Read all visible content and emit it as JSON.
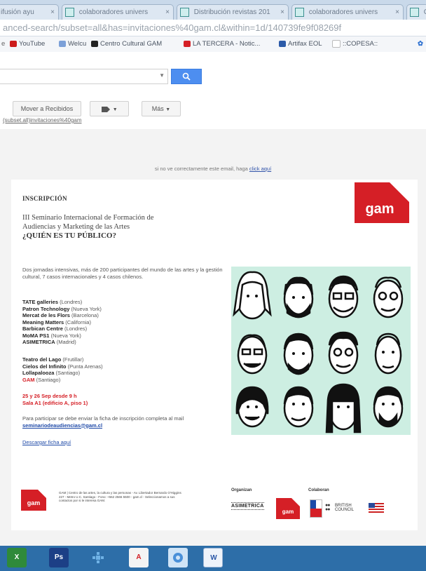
{
  "browser": {
    "tabs": [
      {
        "label": "ifusión ayu"
      },
      {
        "label": "colaboradores univers"
      },
      {
        "label": "Distribución revistas 201"
      },
      {
        "label": "colaboradores univers"
      },
      {
        "label": "C"
      }
    ],
    "url": "anced-search/subset=all&has=invitaciones%40gam.cl&within=1d/140739fe9f08269f",
    "bookmarks": [
      {
        "label": "YouTube",
        "color": "#cc1b1b"
      },
      {
        "label": "Welcu",
        "color": "#7ca0d8"
      },
      {
        "label": "Centro Cultural GAM",
        "color": "#222222"
      },
      {
        "label": "LA TERCERA - Notic...",
        "color": "#d51f26"
      },
      {
        "label": "Artifax EOL",
        "color": "#2b5aa8"
      },
      {
        "label": "::COPESA::",
        "color": "#cccccc"
      }
    ]
  },
  "gmail": {
    "search_placeholder": "",
    "move_button": "Mover a Recibidos",
    "labels_icon": "label-icon",
    "more_button": "Más"
  },
  "email": {
    "cut_line": "(subset.all)invitaciones%40gam",
    "notice_text": "si no ve correctamente este email, haga",
    "notice_link": "click aquí",
    "heading": "INSCRIPCIÓN",
    "subtitle_line1": "III Seminario Internacional de Formación de",
    "subtitle_line2": "Audiencias y Marketing de las Artes",
    "subtitle_question": "¿QUIÉN ES TU PÚBLICO?",
    "description": "Dos jornadas intensivas, más de 200 participantes del mundo de las artes y la gestión cultural, 7 casos internacionales y 4 casos chilenos.",
    "international": [
      {
        "name": "TATE galleries",
        "place": "(Londres)"
      },
      {
        "name": "Patron Technology",
        "place": "(Nueva York)"
      },
      {
        "name": "Mercat de les Flors",
        "place": "(Barcelona)"
      },
      {
        "name": "Meaning Matters",
        "place": "(California)"
      },
      {
        "name": "Barbican Centre",
        "place": "(Londres)"
      },
      {
        "name": "MoMA PS1",
        "place": "(Nueva York)"
      },
      {
        "name": "ASIMETRICA",
        "place": "(Madrid)"
      }
    ],
    "chilean": [
      {
        "name": "Teatro del Lago",
        "place": "(Frutillar)"
      },
      {
        "name": "Cielos del Infinito",
        "place": "(Punta Arenas)"
      },
      {
        "name": "Lollapalooza",
        "place": "(Santiago)"
      },
      {
        "name": "GAM",
        "place": "(Santiago)"
      }
    ],
    "date_line1": "25 y 26 Sep desde 9 h",
    "date_line2": "Sala A1 (edificio A, piso 1)",
    "participate_text": "Para participar se debe enviar la ficha de inscripción completa al mail",
    "participate_email": "seminariodeaudiencias@gam.cl",
    "download_link": "Descargar ficha aquí",
    "logo_text": "gam",
    "footer_text": "GAM | Centro de las artes, la cultura y las personas - Av. Libertador Bernardo O'Higgins 227 - Metro U.C. Santiago - Fono: +562 2566 5500 - gam.cl - Seleccionamos a sus contactos por si le interesa GAM.",
    "organizan_label": "Organizan",
    "colaboran_label": "Colaboran",
    "asimetrica_logo": "ASIMETRICA",
    "british_council_line1": "BRITISH",
    "british_council_line2": "COUNCIL"
  },
  "taskbar": {
    "items": [
      {
        "icon": "excel-icon",
        "label": "X",
        "color": "#2f8a3a"
      },
      {
        "icon": "photoshop-icon",
        "label": "Ps",
        "color": "#1c3f86"
      },
      {
        "icon": "network-icon",
        "label": "",
        "color": "#6fb2e6"
      },
      {
        "icon": "acrobat-icon",
        "label": "A",
        "color": "#d21f26"
      },
      {
        "icon": "browser-icon",
        "label": "",
        "color": "#4a90d8"
      },
      {
        "icon": "word-icon",
        "label": "W",
        "color": "#2a57a8"
      }
    ]
  },
  "colors": {
    "gam_red": "#d51f26",
    "link_blue": "#1f4aa8",
    "faces_bg": "#cdeee2"
  }
}
